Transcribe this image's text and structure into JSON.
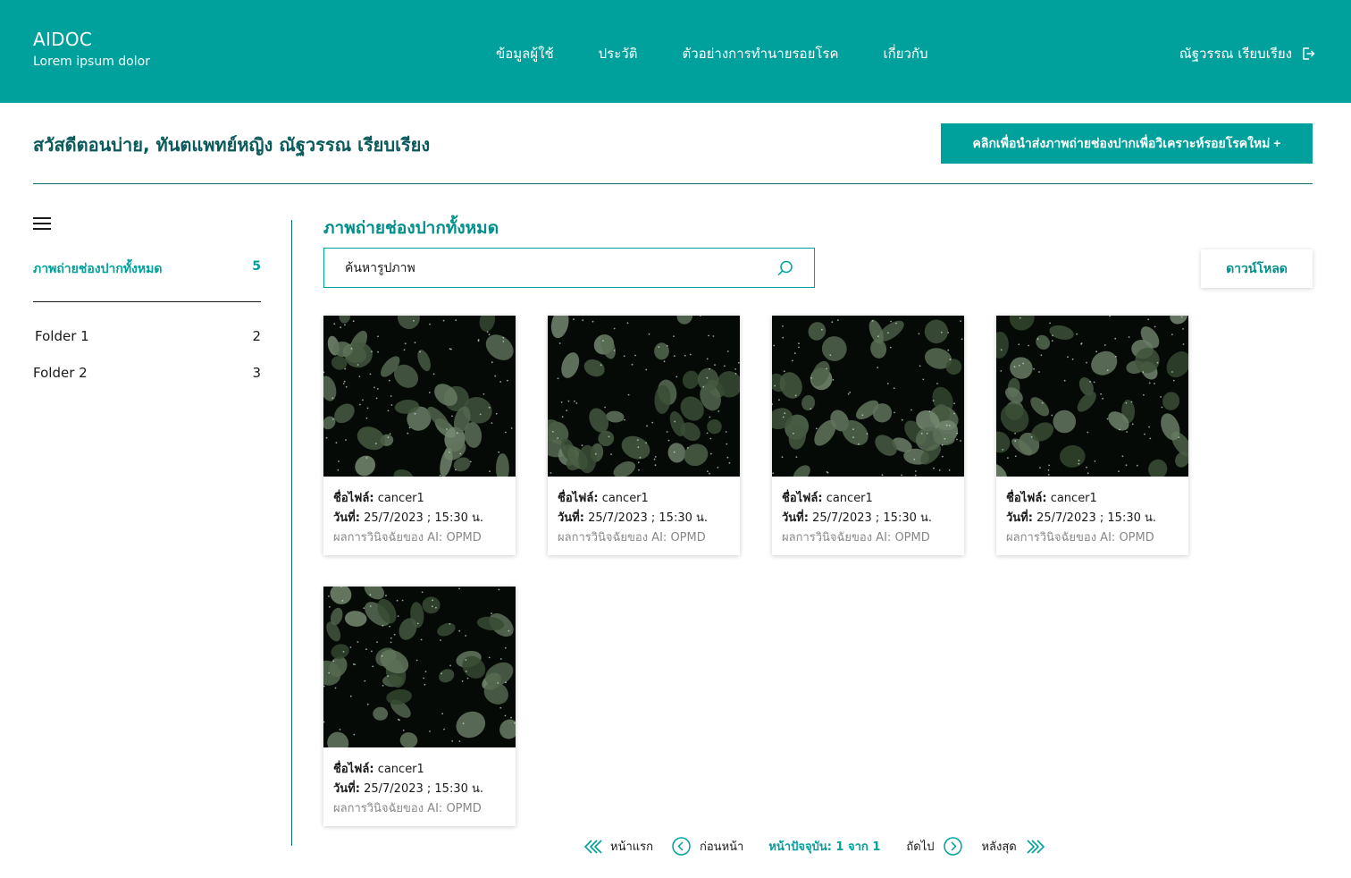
{
  "header": {
    "brand_title": "AIDOC",
    "brand_subtitle": "Lorem ipsum dolor",
    "nav": [
      "ข้อมูลผู้ใช้",
      "ประวัติ",
      "ตัวอย่างการทำนายรอยโรค",
      "เกี่ยวกับ"
    ],
    "user_name": "ณัฐวรรณ เรียบเรียง"
  },
  "greeting": "สวัสดีตอนบ่าย, ทันตแพทย์หญิง ณัฐวรรณ เรียบเรียง",
  "new_button": "คลิกเพื่อนำส่งภาพถ่ายช่องปากเพื่อวิเคราะห์รอยโรคใหม่ +",
  "sidebar": {
    "all_label": "ภาพถ่ายช่องปากทั้งหมด",
    "all_count": "5",
    "folders": [
      {
        "label": "Folder 1",
        "count": "2"
      },
      {
        "label": "Folder 2",
        "count": "3"
      }
    ]
  },
  "main": {
    "title": "ภาพถ่ายช่องปากทั้งหมด",
    "search_placeholder": "ค้นหารูปภาพ",
    "download_label": "ดาวน์โหลด",
    "cards": [
      {
        "file_label": "ชื่อไฟล์:",
        "file": "cancer1",
        "date_label": "วันที่:",
        "date": "25/7/2023 ; 15:30 น.",
        "result_label": "ผลการวินิจฉัยของ AI:",
        "result": "OPMD"
      },
      {
        "file_label": "ชื่อไฟล์:",
        "file": "cancer1",
        "date_label": "วันที่:",
        "date": "25/7/2023 ; 15:30 น.",
        "result_label": "ผลการวินิจฉัยของ AI:",
        "result": "OPMD"
      },
      {
        "file_label": "ชื่อไฟล์:",
        "file": "cancer1",
        "date_label": "วันที่:",
        "date": "25/7/2023 ; 15:30 น.",
        "result_label": "ผลการวินิจฉัยของ AI:",
        "result": "OPMD"
      },
      {
        "file_label": "ชื่อไฟล์:",
        "file": "cancer1",
        "date_label": "วันที่:",
        "date": "25/7/2023 ; 15:30 น.",
        "result_label": "ผลการวินิจฉัยของ AI:",
        "result": "OPMD"
      },
      {
        "file_label": "ชื่อไฟล์:",
        "file": "cancer1",
        "date_label": "วันที่:",
        "date": "25/7/2023 ; 15:30 น.",
        "result_label": "ผลการวินิจฉัยของ AI:",
        "result": "OPMD"
      }
    ]
  },
  "pagination": {
    "first": "หน้าแรก",
    "prev": "ก่อนหน้า",
    "current": "หน้าปัจจุบัน: 1 จาก 1",
    "next": "ถัดไป",
    "last": "หลังสุด"
  },
  "colors": {
    "accent": "#00a19c",
    "dark_teal": "#0a5a5c"
  }
}
